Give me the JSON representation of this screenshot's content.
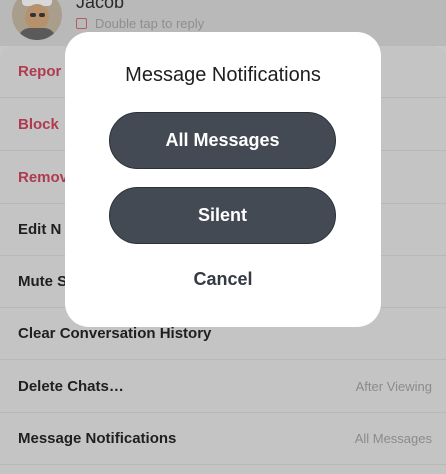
{
  "header": {
    "contact_name": "Jacob",
    "reply_hint": "Double tap to reply",
    "reply_icon": "chat-square-icon"
  },
  "sheet": {
    "rows": [
      {
        "label": "Repor",
        "value": "",
        "danger": true
      },
      {
        "label": "Block",
        "value": "",
        "danger": true
      },
      {
        "label": "Remov",
        "value": "",
        "danger": true
      },
      {
        "label": "Edit N",
        "value": "",
        "danger": false
      },
      {
        "label": "Mute S",
        "value": "",
        "danger": false
      },
      {
        "label": "Clear Conversation History",
        "value": "",
        "danger": false
      },
      {
        "label": "Delete Chats…",
        "value": "After Viewing",
        "danger": false
      },
      {
        "label": "Message Notifications",
        "value": "All Messages",
        "danger": false
      }
    ]
  },
  "modal": {
    "title": "Message Notifications",
    "option_all": "All Messages",
    "option_silent": "Silent",
    "cancel_label": "Cancel"
  },
  "colors": {
    "danger_text": "#b03a4e",
    "pill_bg": "#444a54",
    "overlay_bg": "#c4c4c4"
  }
}
